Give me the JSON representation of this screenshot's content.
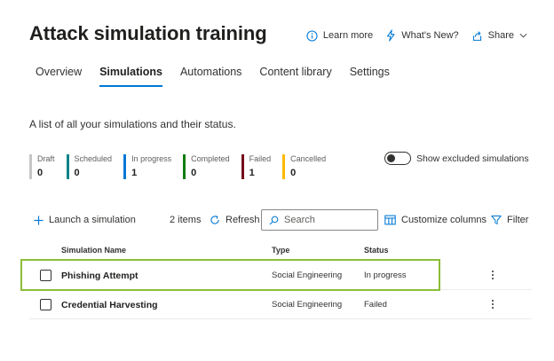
{
  "header": {
    "title": "Attack simulation training",
    "actions": [
      {
        "icon": "info-icon",
        "label": "Learn more"
      },
      {
        "icon": "lightning-icon",
        "label": "What's New?"
      },
      {
        "icon": "share-icon",
        "label": "Share"
      }
    ]
  },
  "tabs": [
    {
      "label": "Overview",
      "active": false
    },
    {
      "label": "Simulations",
      "active": true
    },
    {
      "label": "Automations",
      "active": false
    },
    {
      "label": "Content library",
      "active": false
    },
    {
      "label": "Settings",
      "active": false
    }
  ],
  "description": "A list of all your simulations and their status.",
  "stats": [
    {
      "label": "Draft",
      "count": "0",
      "color": "#c8c6c4"
    },
    {
      "label": "Scheduled",
      "count": "0",
      "color": "#038387"
    },
    {
      "label": "In progress",
      "count": "1",
      "color": "#0078d4"
    },
    {
      "label": "Completed",
      "count": "0",
      "color": "#107c10"
    },
    {
      "label": "Failed",
      "count": "1",
      "color": "#750b1c"
    },
    {
      "label": "Cancelled",
      "count": "0",
      "color": "#ffb900"
    }
  ],
  "toggle": {
    "label": "Show excluded simulations",
    "on": false
  },
  "toolbar": {
    "launch_label": "Launch a simulation",
    "items_count": "2 items",
    "refresh_label": "Refresh",
    "search_placeholder": "Search",
    "customize_label": "Customize columns",
    "filter_label": "Filter"
  },
  "table": {
    "columns": [
      "Simulation Name",
      "Type",
      "Status"
    ],
    "rows": [
      {
        "name": "Phishing Attempt",
        "type": "Social Engineering",
        "status": "In progress",
        "highlighted": true
      },
      {
        "name": "Credential Harvesting",
        "type": "Social Engineering",
        "status": "Failed",
        "highlighted": false
      }
    ]
  },
  "colors": {
    "accent": "#0078d4",
    "highlight": "#8cbd3a"
  }
}
